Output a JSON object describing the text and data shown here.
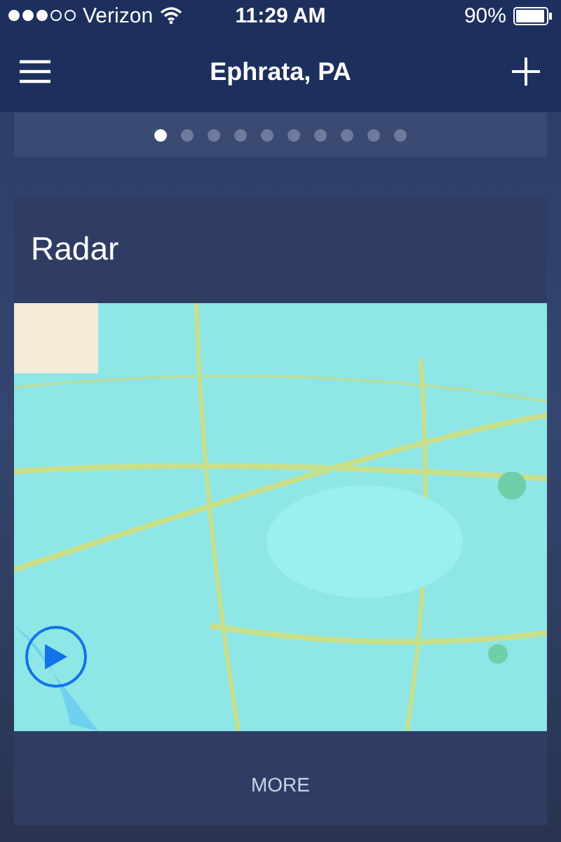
{
  "status_bar": {
    "carrier": "Verizon",
    "time": "11:29 AM",
    "battery": "90%"
  },
  "nav": {
    "title": "Ephrata, PA"
  },
  "pages": [
    {
      "selected": true
    },
    {
      "selected": false
    },
    {
      "selected": false
    },
    {
      "selected": false
    },
    {
      "selected": false
    },
    {
      "selected": false
    },
    {
      "selected": false
    },
    {
      "selected": false
    },
    {
      "selected": false
    },
    {
      "selected": false
    }
  ],
  "card": {
    "title": "Radar",
    "more": "MORE"
  }
}
